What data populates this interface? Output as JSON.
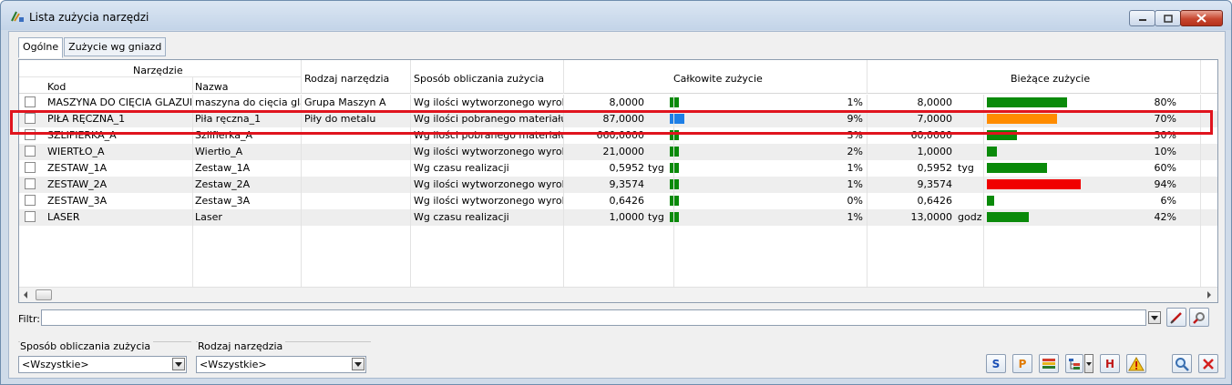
{
  "window": {
    "title": "Lista zużycia narzędzi"
  },
  "tabs": [
    {
      "label": "Ogólne",
      "active": true
    },
    {
      "label": "Zużycie wg gniazd",
      "active": false
    }
  ],
  "grid": {
    "group_headers": {
      "narzedzie": "Narzędzie",
      "calkowite": "Całkowite zużycie",
      "biezace": "Bieżące zużycie"
    },
    "headers": {
      "kod": "Kod",
      "nazwa": "Nazwa",
      "rodzaj": "Rodzaj narzędzia",
      "sposob": "Sposób obliczania zużycia"
    },
    "rows": [
      {
        "kod": "MASZYNA DO CIĘCIA GLAZURY",
        "nazwa": "maszyna do cięcia glazury",
        "rodzaj": "Grupa Maszyn A",
        "sposob": "Wg ilości wytworzonego wyrobu",
        "cal_val": "8,0000",
        "cal_unit": "",
        "cal_pct": "1%",
        "cal_frac": 0.01,
        "cal_color": "#0a8a0a",
        "bie_val": "8,0000",
        "bie_unit": "",
        "bie_pct": "80%",
        "bie_frac": 0.8,
        "bie_color": "#0a8a0a"
      },
      {
        "kod": "PIŁA RĘCZNA_1",
        "nazwa": "Piła ręczna_1",
        "rodzaj": "Piły do metalu",
        "sposob": "Wg ilości pobranego materiału",
        "cal_val": "87,0000",
        "cal_unit": "",
        "cal_pct": "9%",
        "cal_frac": 0.09,
        "cal_color": "#1e7fe6",
        "bie_val": "7,0000",
        "bie_unit": "",
        "bie_pct": "70%",
        "bie_frac": 0.7,
        "bie_color": "#ff8c00"
      },
      {
        "kod": "SZLIFIERKA_A",
        "nazwa": "Szlifierka_A",
        "rodzaj": "",
        "sposob": "Wg ilości pobranego materiału",
        "cal_val": "660,0000",
        "cal_unit": "",
        "cal_pct": "3%",
        "cal_frac": 0.03,
        "cal_color": "#0a8a0a",
        "bie_val": "60,0000",
        "bie_unit": "",
        "bie_pct": "30%",
        "bie_frac": 0.3,
        "bie_color": "#0a8a0a"
      },
      {
        "kod": "WIERTŁO_A",
        "nazwa": "Wiertło_A",
        "rodzaj": "",
        "sposob": "Wg ilości wytworzonego wyrobu",
        "cal_val": "21,0000",
        "cal_unit": "",
        "cal_pct": "2%",
        "cal_frac": 0.02,
        "cal_color": "#0a8a0a",
        "bie_val": "1,0000",
        "bie_unit": "",
        "bie_pct": "10%",
        "bie_frac": 0.1,
        "bie_color": "#0a8a0a"
      },
      {
        "kod": "ZESTAW_1A",
        "nazwa": "Zestaw_1A",
        "rodzaj": "",
        "sposob": "Wg czasu realizacji",
        "cal_val": "0,5952",
        "cal_unit": "tyg",
        "cal_pct": "1%",
        "cal_frac": 0.01,
        "cal_color": "#0a8a0a",
        "bie_val": "0,5952",
        "bie_unit": "tyg",
        "bie_pct": "60%",
        "bie_frac": 0.6,
        "bie_color": "#0a8a0a"
      },
      {
        "kod": "ZESTAW_2A",
        "nazwa": "Zestaw_2A",
        "rodzaj": "",
        "sposob": "Wg ilości wytworzonego wyrobu",
        "cal_val": "9,3574",
        "cal_unit": "",
        "cal_pct": "1%",
        "cal_frac": 0.01,
        "cal_color": "#0a8a0a",
        "bie_val": "9,3574",
        "bie_unit": "",
        "bie_pct": "94%",
        "bie_frac": 0.94,
        "bie_color": "#f00000"
      },
      {
        "kod": "ZESTAW_3A",
        "nazwa": "Zestaw_3A",
        "rodzaj": "",
        "sposob": "Wg ilości wytworzonego wyrobu",
        "cal_val": "0,6426",
        "cal_unit": "",
        "cal_pct": "0%",
        "cal_frac": 0.0,
        "cal_color": "#0a8a0a",
        "bie_val": "0,6426",
        "bie_unit": "",
        "bie_pct": "6%",
        "bie_frac": 0.06,
        "bie_color": "#0a8a0a"
      },
      {
        "kod": "LASER",
        "nazwa": "Laser",
        "rodzaj": "",
        "sposob": "Wg czasu realizacji",
        "cal_val": "1,0000",
        "cal_unit": "tyg",
        "cal_pct": "1%",
        "cal_frac": 0.01,
        "cal_color": "#0a8a0a",
        "bie_val": "13,0000",
        "bie_unit": "godz",
        "bie_pct": "42%",
        "bie_frac": 0.42,
        "bie_color": "#0a8a0a"
      }
    ]
  },
  "filter": {
    "label": "Filtr:",
    "value": ""
  },
  "filters": {
    "sposob": {
      "label": "Sposób obliczania zużycia",
      "value": "<Wszystkie>"
    },
    "rodzaj": {
      "label": "Rodzaj narzędzia",
      "value": "<Wszystkie>"
    }
  },
  "toolbar": {
    "s_label": "S",
    "p_label": "P",
    "h_label": "H"
  }
}
